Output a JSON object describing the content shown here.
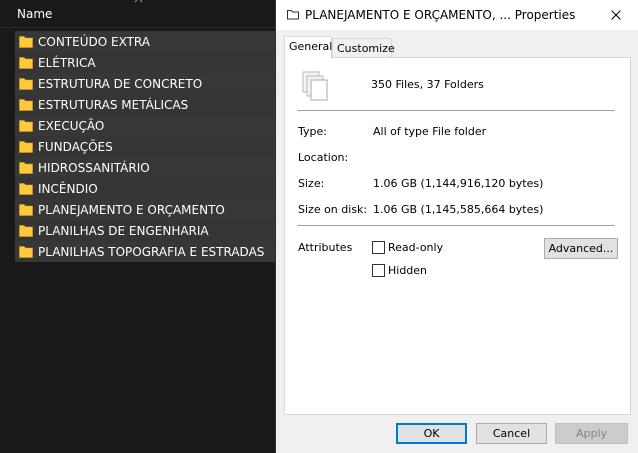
{
  "explorer": {
    "column_header": "Name",
    "folders": [
      "CONTEÚDO EXTRA",
      "ELÉTRICA",
      "ESTRUTURA DE CONCRETO",
      "ESTRUTURAS METÁLICAS",
      "EXECUÇÃO",
      "FUNDAÇÕES",
      "HIDROSSANITÁRIO",
      "INCÊNDIO",
      "PLANEJAMENTO E ORÇAMENTO",
      "PLANILHAS DE ENGENHARIA",
      "PLANILHAS TOPOGRAFIA E ESTRADAS"
    ],
    "folder_icon": "folder-icon",
    "colors": {
      "folder": "#ffc83d",
      "row_bg": "#373737"
    }
  },
  "dialog": {
    "title": "PLANEJAMENTO E ORÇAMENTO, ... Properties",
    "tabs": [
      {
        "label": "General",
        "active": true
      },
      {
        "label": "Customize",
        "active": false
      }
    ],
    "counts": "350 Files, 37 Folders",
    "type_label": "Type:",
    "type_value": "All of type File folder",
    "location_label": "Location:",
    "location_value": "",
    "size_label": "Size:",
    "size_value": "1.06 GB (1,144,916,120 bytes)",
    "size_on_disk_label": "Size on disk:",
    "size_on_disk_value": "1.06 GB (1,145,585,664 bytes)",
    "attributes_label": "Attributes",
    "readonly_label": "Read-only",
    "hidden_label": "Hidden",
    "advanced_button": "Advanced...",
    "ok_button": "OK",
    "cancel_button": "Cancel",
    "apply_button": "Apply",
    "accent_color": "#0078d7"
  }
}
